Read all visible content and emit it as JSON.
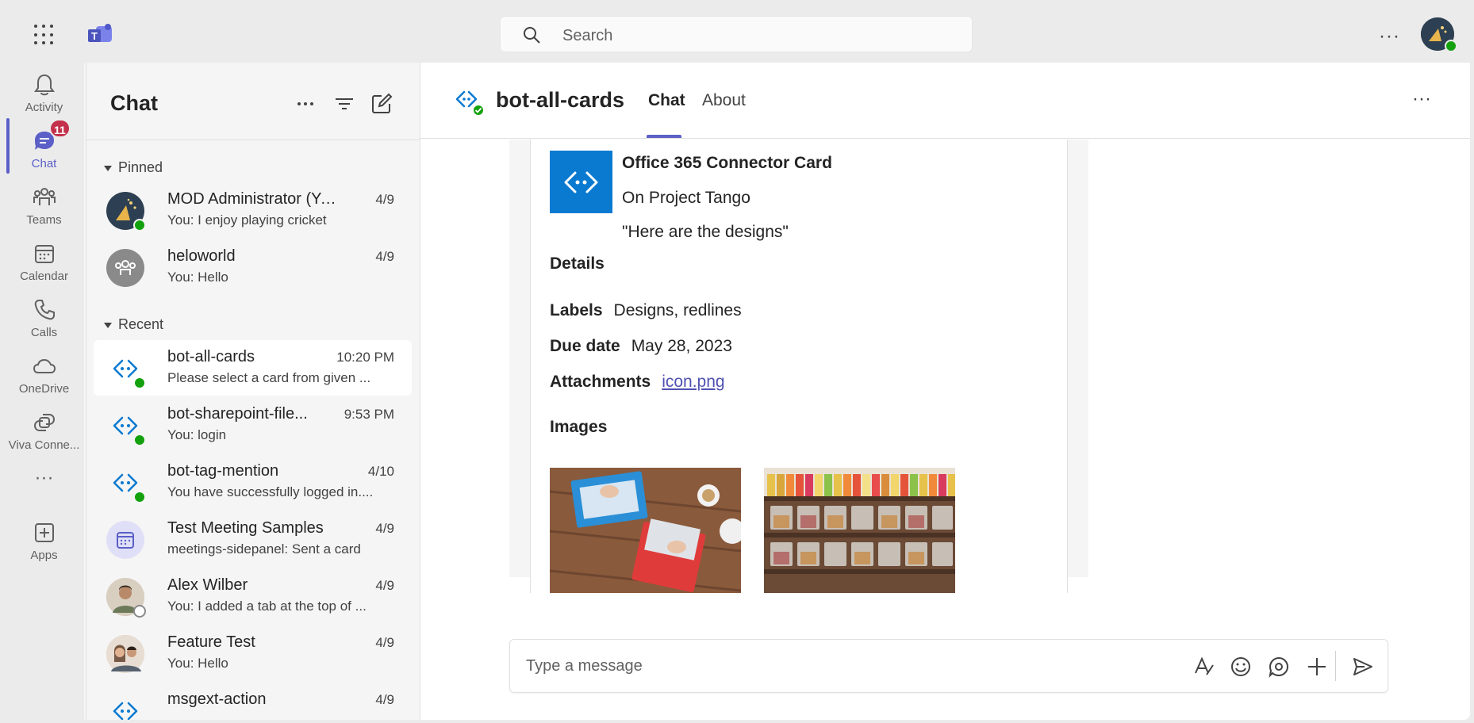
{
  "titlebar": {
    "search_placeholder": "Search",
    "more_label": "···"
  },
  "rail": {
    "items": [
      {
        "label": "Activity",
        "icon": "bell-icon"
      },
      {
        "label": "Chat",
        "icon": "chat-icon",
        "badge": "11"
      },
      {
        "label": "Teams",
        "icon": "teams-icon"
      },
      {
        "label": "Calendar",
        "icon": "calendar-icon"
      },
      {
        "label": "Calls",
        "icon": "phone-icon"
      },
      {
        "label": "OneDrive",
        "icon": "cloud-icon"
      },
      {
        "label": "Viva Conne...",
        "icon": "viva-connections-icon"
      },
      {
        "label": "···",
        "icon": "more-icon"
      },
      {
        "label": "Apps",
        "icon": "add-apps-icon"
      }
    ]
  },
  "chatlist": {
    "title": "Chat",
    "pinned_label": "Pinned",
    "recent_label": "Recent",
    "pinned": [
      {
        "name": "MOD Administrator (Yo...",
        "preview": "You: I enjoy playing cricket",
        "time": "4/9"
      },
      {
        "name": "heloworld",
        "preview": "You: Hello",
        "time": "4/9"
      }
    ],
    "recent": [
      {
        "name": "bot-all-cards",
        "preview": "Please select a card from given ...",
        "time": "10:20 PM"
      },
      {
        "name": "bot-sharepoint-file...",
        "preview": "You: login",
        "time": "9:53 PM"
      },
      {
        "name": "bot-tag-mention",
        "preview": "You have successfully logged in....",
        "time": "4/10"
      },
      {
        "name": "Test Meeting Samples",
        "preview": "meetings-sidepanel: Sent a card",
        "time": "4/9"
      },
      {
        "name": "Alex Wilber",
        "preview": "You: I added a tab at the top of ...",
        "time": "4/9"
      },
      {
        "name": "Feature Test",
        "preview": "You: Hello",
        "time": "4/9"
      },
      {
        "name": "msgext-action",
        "preview": "",
        "time": "4/9"
      }
    ]
  },
  "main": {
    "title": "bot-all-cards",
    "tabs": [
      {
        "label": "Chat"
      },
      {
        "label": "About"
      }
    ],
    "more_label": "···"
  },
  "card": {
    "title": "Office 365 Connector Card",
    "subtitle": "On Project Tango",
    "quote": "\"Here are the designs\"",
    "details_heading": "Details",
    "facts": [
      {
        "label": "Labels",
        "value": "Designs, redlines"
      },
      {
        "label": "Due date",
        "value": "May 28, 2023"
      },
      {
        "label": "Attachments",
        "value": "icon.png"
      }
    ],
    "images_heading": "Images"
  },
  "composer": {
    "placeholder": "Type a message"
  },
  "colors": {
    "accent": "#5b5fc7",
    "presence_available": "#13a10e",
    "badge": "#c4314b",
    "card_logo": "#0a7ad1"
  }
}
